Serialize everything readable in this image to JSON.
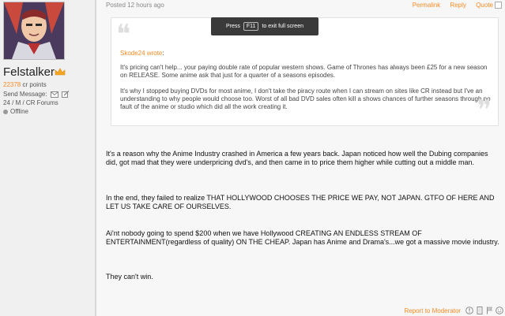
{
  "post": {
    "posted": "Posted 12 hours ago",
    "actions": {
      "permalink": "Permalink",
      "reply": "Reply",
      "quote": "Quote"
    },
    "toast": {
      "prefix": "Press",
      "key": "F11",
      "suffix": "to exit full screen"
    }
  },
  "user": {
    "name": "Felstalker",
    "points_value": "22378",
    "points_label": "cr points",
    "send_message": "Send Message:",
    "info": "24 / M / CR Forums",
    "status": "Offline"
  },
  "quote": {
    "author": "Skode24 wrote",
    "colon": ":",
    "p1": "It's pricing can't help... your paying double rate of popular western shows. Game of Thrones has always been £25 for a new season on RELEASE. Some anime ask that just for a quarter of a seasons episodes.",
    "p2": "It's why I stopped buying DVDs for most anime, I don't take the piracy route when I can stream on sites like CR instead but I've an understanding to why people would choose too. Worst of all bad DVD sales often kill a shows chances of further seasons through no fault of the anime or studio which did all the work creating it."
  },
  "body": {
    "p1": "It's a reason why the Anime Industry crashed in America a few years back. Japan noticed how well the Dubing companies did, got mad that they were underpricing dvd's, and then came in to price them higher while cutting out a middle man.",
    "p2": "In the end, they failed to realize THAT HOLLYWOOD CHOOSES THE PRICE WE PAY, NOT JAPAN. GTFO OF HERE AND LET US TAKE CARE OF OURSELVES.",
    "p3": "Ai'nt nobody going to spend $200 when we have Hollywood CREATING AN ENDLESS STREAM OF ENTERTAINMENT(regardless of quality) ON THE CHEAP. Japan has Anime and Drama's...we got a massive movie industry.",
    "p4": "They can't win."
  },
  "footer": {
    "report": "Report to Moderator"
  },
  "colors": {
    "accent": "#f78b24"
  }
}
